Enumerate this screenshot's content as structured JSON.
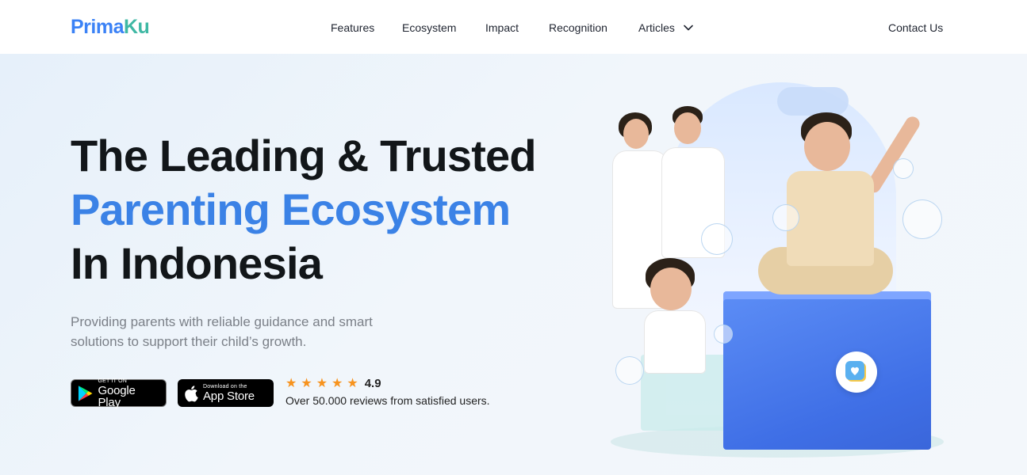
{
  "brand": {
    "logo_part1": "Prima",
    "logo_part2": "Ku"
  },
  "nav": {
    "features": "Features",
    "ecosystem": "Ecosystem",
    "impact": "Impact",
    "recognition": "Recognition",
    "articles": "Articles",
    "contact": "Contact Us"
  },
  "hero": {
    "line1": "The Leading & Trusted",
    "line2": "Parenting Ecosystem",
    "line3": "In Indonesia",
    "subtitle": "Providing parents with reliable guidance and smart solutions to support their child’s growth."
  },
  "stores": {
    "google_small": "GET IT ON",
    "google_big": "Google Play",
    "apple_small": "Download on the",
    "apple_big": "App Store"
  },
  "rating": {
    "stars": 5,
    "score": "4.9",
    "reviews": "Over 50.000 reviews from satisfied users."
  },
  "colors": {
    "brand_blue": "#3b82e6",
    "brand_teal": "#3fb8a4",
    "star": "#f7931e"
  },
  "icons": [
    "chevron-down-icon",
    "google-play-icon",
    "apple-icon",
    "star-icon",
    "heart-icon"
  ]
}
